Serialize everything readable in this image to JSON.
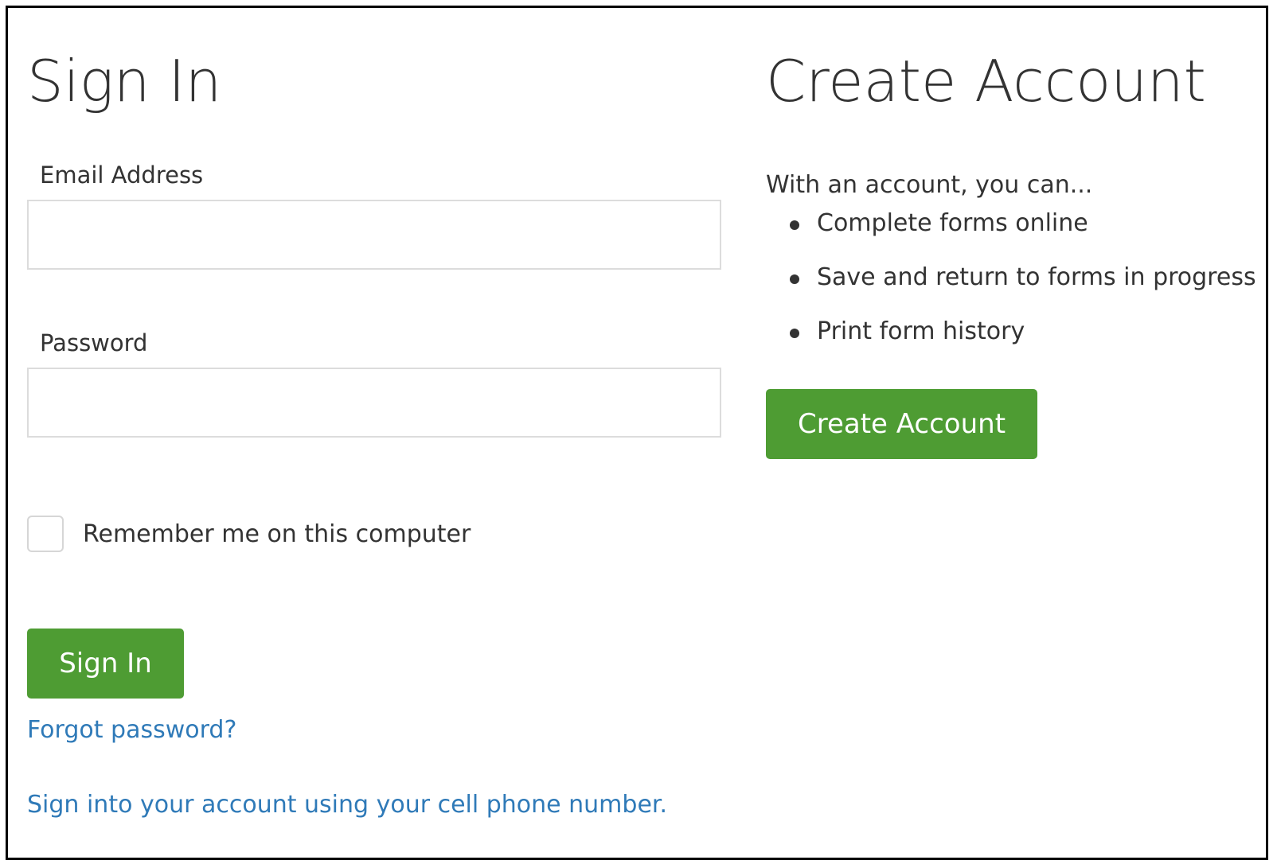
{
  "sign_in": {
    "title": "Sign In",
    "email_label": "Email Address",
    "email_value": "",
    "password_label": "Password",
    "password_value": "",
    "remember_label": "Remember me on this computer",
    "remember_checked": false,
    "submit_label": "Sign In",
    "forgot_link": "Forgot password?",
    "phone_link": "Sign into your account using your cell phone number."
  },
  "create_account": {
    "title": "Create Account",
    "intro": "With an account, you can...",
    "benefits": [
      "Complete forms online",
      "Save and return to forms in progress",
      "Print form history"
    ],
    "button_label": "Create Account"
  },
  "colors": {
    "button_green": "#4e9c33",
    "link_blue": "#2f7ab8",
    "text": "#333333",
    "border": "#000000"
  }
}
